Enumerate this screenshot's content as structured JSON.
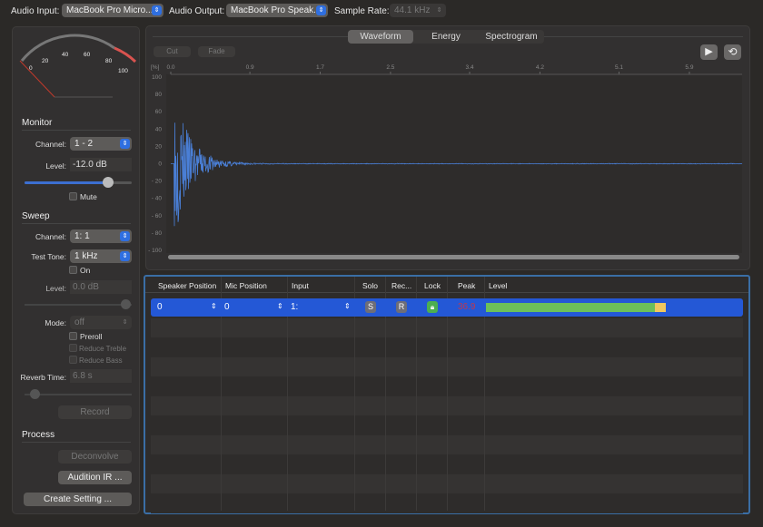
{
  "toolbar": {
    "audio_input_label": "Audio Input:",
    "audio_input": "MacBook Pro Micro...",
    "audio_output_label": "Audio Output:",
    "audio_output": "MacBook Pro Speak...",
    "sample_rate_label": "Sample Rate:",
    "sample_rate": "44.1 kHz"
  },
  "meter": {
    "ticks": [
      "0",
      "20",
      "40",
      "60",
      "80",
      "100"
    ],
    "value": 0
  },
  "monitor": {
    "title": "Monitor",
    "channel_label": "Channel:",
    "channel": "1 - 2",
    "level_label": "Level:",
    "level": "-12.0 dB",
    "slider": 0.75,
    "mute": "Mute"
  },
  "sweep": {
    "title": "Sweep",
    "channel_label": "Channel:",
    "channel": "1: 1",
    "tone_label": "Test Tone:",
    "tone": "1 kHz",
    "on": "On",
    "level_label": "Level:",
    "level": "0.0 dB",
    "mode_label": "Mode:",
    "mode": "off",
    "preroll": "Preroll",
    "reduce_treble": "Reduce Treble",
    "reduce_bass": "Reduce Bass",
    "reverb_label": "Reverb Time:",
    "reverb": "6.8 s",
    "record": "Record"
  },
  "process": {
    "title": "Process",
    "deconvolve": "Deconvolve",
    "audition": "Audition IR ...",
    "create": "Create Setting ..."
  },
  "view": {
    "tabs": [
      "Waveform",
      "Energy",
      "Spectrogram"
    ],
    "selected": "Waveform",
    "cut": "Cut",
    "fade": "Fade",
    "play_icon": "play-icon",
    "loop_icon": "loop-icon"
  },
  "chart_data": {
    "type": "line",
    "yunit": "[%]",
    "xticks": [
      "0.0",
      "0.9",
      "1.7",
      "2.5",
      "3.4",
      "4.2",
      "5.1",
      "5.9"
    ],
    "yticks": [
      "100",
      "80",
      "60",
      "40",
      "20",
      "0",
      "- 20",
      "- 40",
      "- 60",
      "- 80",
      "- 100"
    ],
    "ylim": [
      -100,
      100
    ],
    "xlim": [
      0,
      6.5
    ],
    "color": "#4a7fd6",
    "description": "impulse response decaying from ~78% peak near 0.05"
  },
  "table": {
    "headers": [
      "Speaker Position",
      "Mic Position",
      "Input",
      "Solo",
      "Rec...",
      "Lock",
      "Peak",
      "Level"
    ],
    "rows": [
      {
        "speaker": "0",
        "mic": "0",
        "input": "1:",
        "solo": "S",
        "rec": "R",
        "peak": "36.9",
        "level": 0.93
      }
    ],
    "colors": {
      "selected": "#2458d6",
      "level_green": "#6cc05a",
      "level_yellow": "#f0c75e",
      "peak": "#c0394e",
      "lock": "#4caf50"
    }
  }
}
